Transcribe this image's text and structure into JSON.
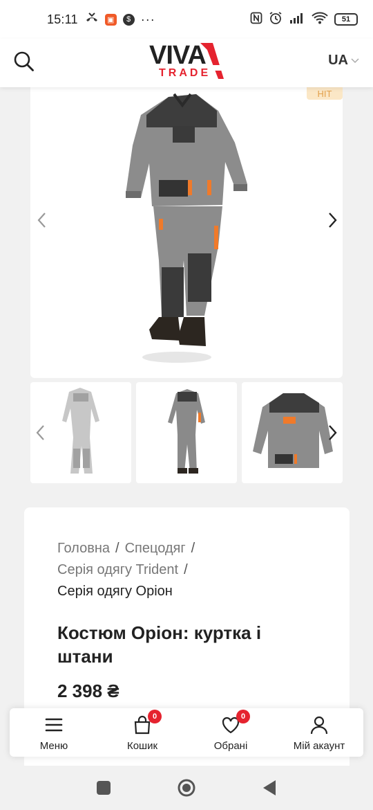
{
  "status_bar": {
    "time": "15:11",
    "battery": "51"
  },
  "header": {
    "logo_top": "VIVA",
    "logo_bottom": "TRADE",
    "language": "UA",
    "brand_red": "#e5232f"
  },
  "gallery": {
    "badge": "НІТ",
    "prev_icon": "chevron-left-icon",
    "next_icon": "chevron-right-icon"
  },
  "product": {
    "breadcrumbs": [
      "Головна",
      "Спецодяг",
      "Серія одягу Trident",
      "Серія одягу Оріон"
    ],
    "breadcrumb_separator": "/",
    "title": "Костюм Оріон: куртка і штани",
    "price": "2 398 ₴"
  },
  "bottom_nav": [
    {
      "label": "Меню",
      "icon": "menu-icon"
    },
    {
      "label": "Кошик",
      "icon": "cart-icon",
      "badge": "0"
    },
    {
      "label": "Обрані",
      "icon": "heart-icon",
      "badge": "0"
    },
    {
      "label": "Мій акаунт",
      "icon": "user-icon"
    }
  ]
}
